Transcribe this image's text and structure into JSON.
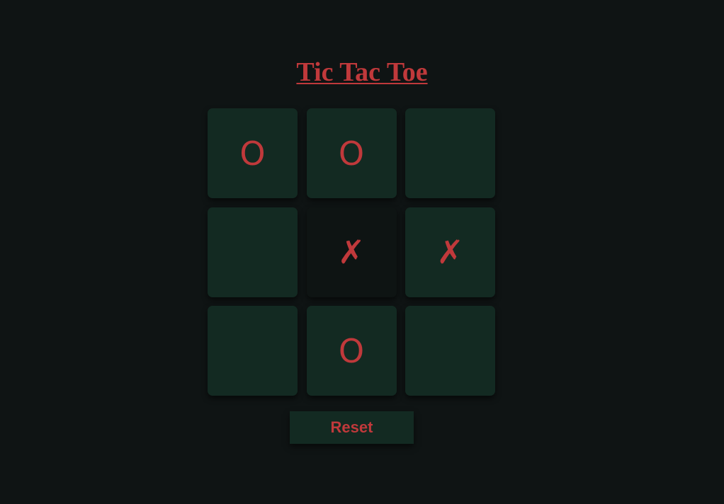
{
  "title": "Tic Tac Toe",
  "board": {
    "cells": [
      {
        "mark": "O",
        "highlighted": false
      },
      {
        "mark": "O",
        "highlighted": false
      },
      {
        "mark": "",
        "highlighted": false
      },
      {
        "mark": "",
        "highlighted": false
      },
      {
        "mark": "✗",
        "highlighted": true
      },
      {
        "mark": "✗",
        "highlighted": false
      },
      {
        "mark": "",
        "highlighted": false
      },
      {
        "mark": "O",
        "highlighted": false
      },
      {
        "mark": "",
        "highlighted": false
      }
    ]
  },
  "controls": {
    "reset_label": "Reset"
  },
  "colors": {
    "background": "#0f1414",
    "cell": "#132a22",
    "cell_highlighted": "#0e1413",
    "accent": "#c0393b"
  }
}
